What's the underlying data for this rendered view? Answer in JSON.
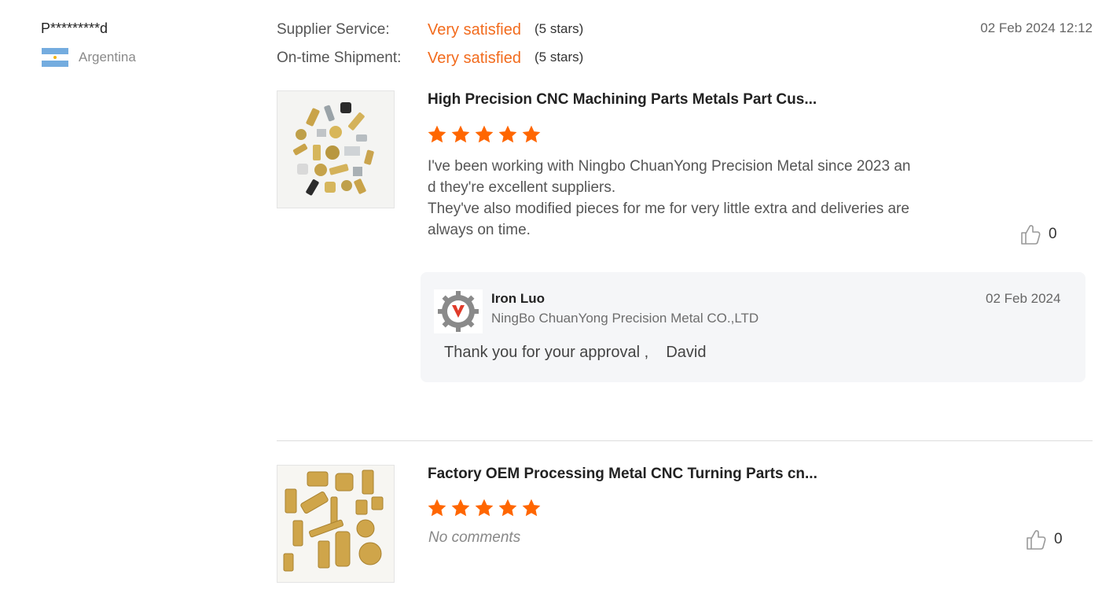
{
  "reviewer": {
    "name": "P*********d",
    "country": "Argentina"
  },
  "ratings": [
    {
      "label": "Supplier Service:",
      "value": "Very satisfied",
      "stars": "(5 stars)"
    },
    {
      "label": "On-time Shipment:",
      "value": "Very satisfied",
      "stars": "(5 stars)"
    }
  ],
  "review_date": "02 Feb 2024 12:12",
  "products": [
    {
      "title": "High Precision CNC Machining Parts Metals Part Cus...",
      "rating": 5,
      "comment_lines": [
        "I've been working with Ningbo ChuanYong Precision Metal since 2023 an",
        "d they're excellent suppliers.",
        "They've also modified pieces for me for very little extra and deliveries are",
        "always on time."
      ],
      "likes": "0"
    },
    {
      "title": "Factory OEM Processing Metal CNC Turning Parts cn...",
      "rating": 5,
      "no_comments": "No comments",
      "likes": "0"
    }
  ],
  "reply": {
    "name": "Iron Luo",
    "company": "NingBo ChuanYong Precision Metal CO.,LTD",
    "date": "02 Feb 2024",
    "text": "Thank you for your approval ,    David"
  },
  "colors": {
    "accent": "#f26b1d",
    "star": "#ff6600",
    "reply_bg": "#f5f6f8"
  },
  "icons": {
    "like": "thumbs-up-icon",
    "star": "star-icon"
  }
}
